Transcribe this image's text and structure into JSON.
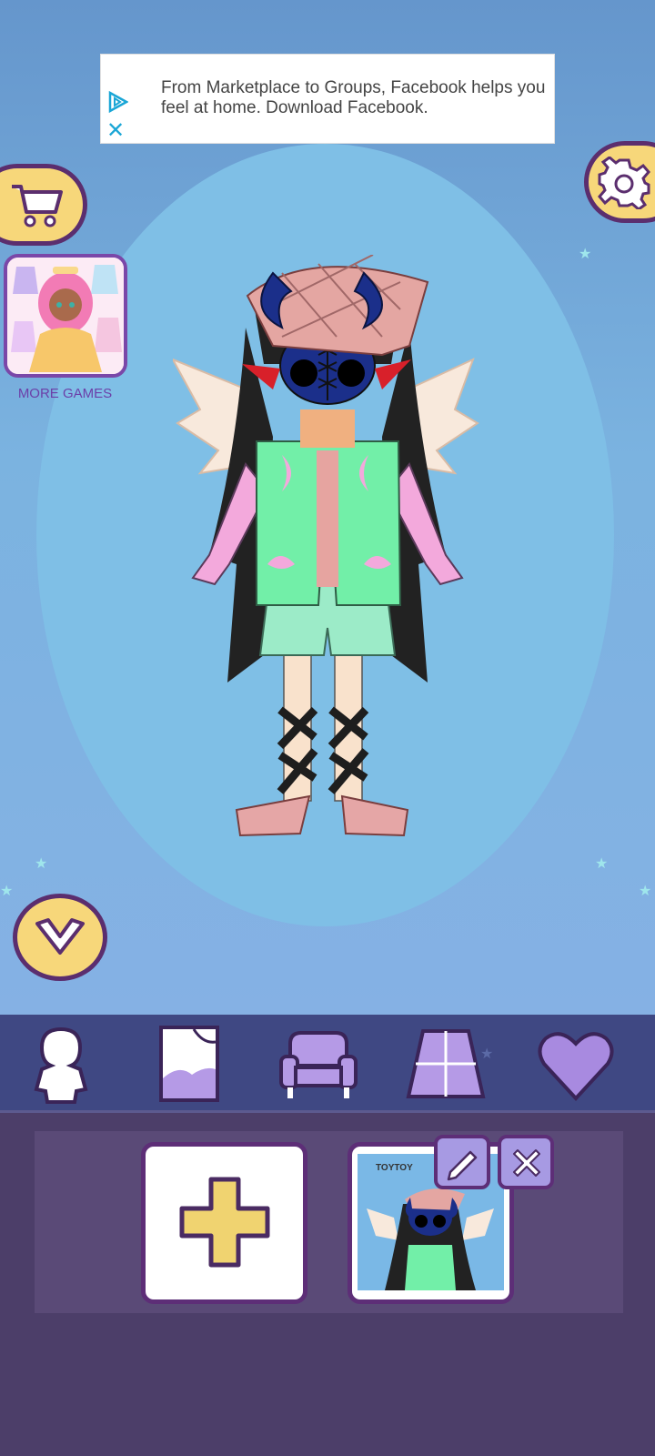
{
  "ad": {
    "text": "From Marketplace to Groups, Facebook helps you feel at home. Download Facebook.",
    "play_icon": "adchoices-play-icon",
    "close_icon": "close-icon"
  },
  "sidebar": {
    "shop_icon": "cart-icon",
    "settings_icon": "gear-icon",
    "more_games_label": "MORE GAMES",
    "collapse_icon": "chevron-down-icon"
  },
  "tabs": [
    {
      "name": "character",
      "icon": "character-silhouette-icon"
    },
    {
      "name": "background",
      "icon": "background-frame-icon"
    },
    {
      "name": "furniture",
      "icon": "sofa-icon"
    },
    {
      "name": "floor",
      "icon": "floor-tiles-icon"
    },
    {
      "name": "favorites",
      "icon": "heart-icon"
    }
  ],
  "saves": {
    "add_icon": "plus-icon",
    "slot_brand": "TOYTOY",
    "edit_icon": "pencil-icon",
    "delete_icon": "close-icon"
  },
  "colors": {
    "accent_yellow": "#f7d77a",
    "outline_purple": "#5b2e6e",
    "tabbar": "#3f4883",
    "panel": "#4c3e69"
  }
}
